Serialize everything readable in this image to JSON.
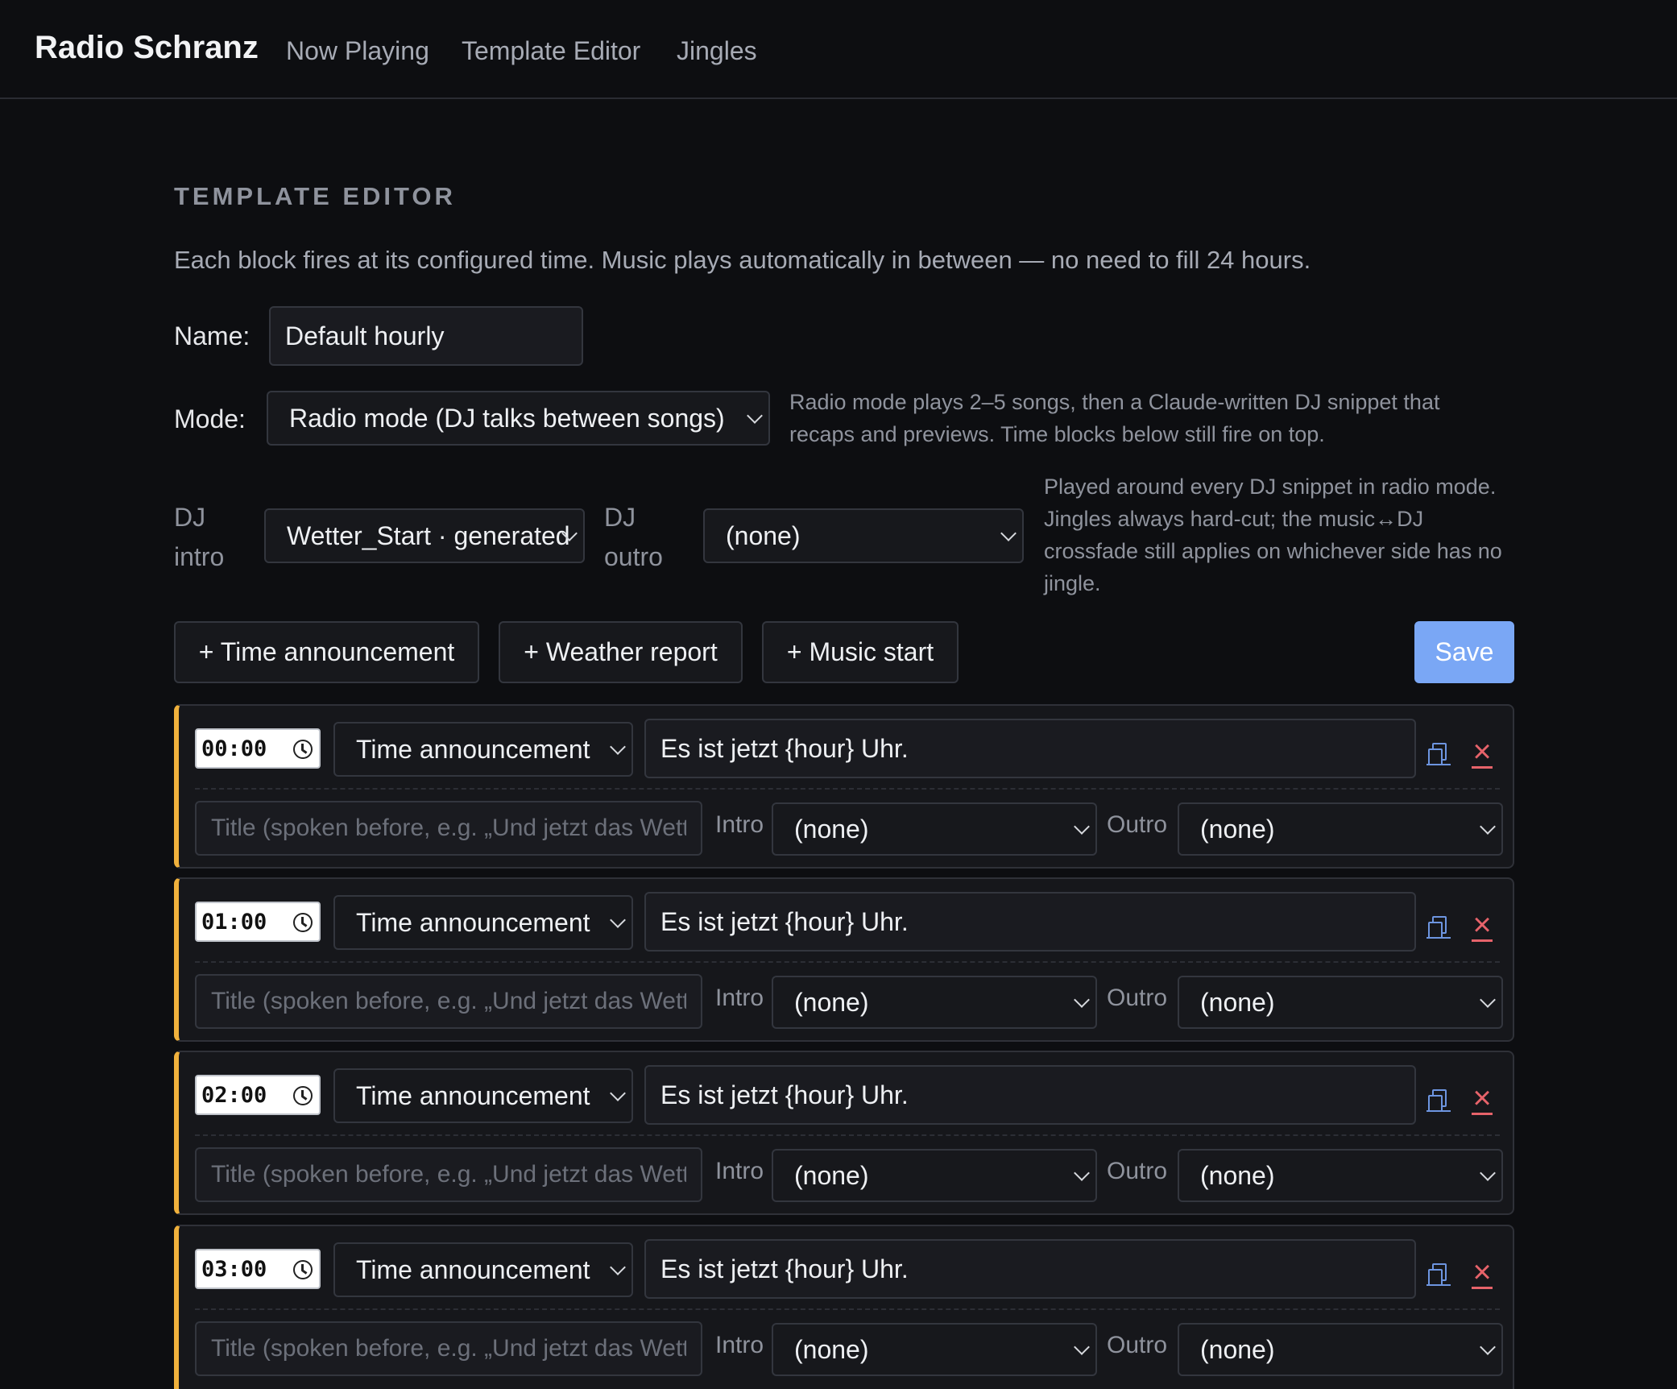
{
  "nav": {
    "brand": "Radio Schranz",
    "links": [
      "Now Playing",
      "Template Editor",
      "Jingles"
    ]
  },
  "editor": {
    "section_title": "TEMPLATE EDITOR",
    "intro": "Each block fires at its configured time. Music plays automatically in between — no need to fill 24 hours.",
    "name_label": "Name:",
    "name_value": "Default hourly",
    "mode_label": "Mode:",
    "mode_value": "Radio mode (DJ talks between songs)",
    "mode_hint": "Radio mode plays 2–5 songs, then a Claude-written DJ snippet that recaps and previews. Time blocks below still fire on top.",
    "dj_intro_label": "DJ intro",
    "dj_intro_value": "Wetter_Start · generated",
    "dj_outro_label": "DJ outro",
    "dj_outro_value": "(none)",
    "dj_hint": "Played around every DJ snippet in radio mode. Jingles always hard-cut; the music↔DJ crossfade still applies on whichever side has no jingle.",
    "add_buttons": [
      "+ Time announcement",
      "+ Weather report",
      "+ Music start"
    ],
    "save_label": "Save"
  },
  "block_labels": {
    "title_placeholder": "Title (spoken before, e.g. „Und jetzt das Wetter“)",
    "intro_label": "Intro",
    "outro_label": "Outro"
  },
  "blocks": [
    {
      "time": "00:00",
      "type": "Time announcement",
      "text": "Es ist jetzt {hour} Uhr.",
      "intro": "(none)",
      "outro": "(none)"
    },
    {
      "time": "01:00",
      "type": "Time announcement",
      "text": "Es ist jetzt {hour} Uhr.",
      "intro": "(none)",
      "outro": "(none)"
    },
    {
      "time": "02:00",
      "type": "Time announcement",
      "text": "Es ist jetzt {hour} Uhr.",
      "intro": "(none)",
      "outro": "(none)"
    },
    {
      "time": "03:00",
      "type": "Time announcement",
      "text": "Es ist jetzt {hour} Uhr.",
      "intro": "(none)",
      "outro": "(none)"
    }
  ],
  "colors": {
    "background": "#0d0e11",
    "accent": "#7aa7f5",
    "block_border": "#f0b13c",
    "delete": "#e6636a"
  }
}
